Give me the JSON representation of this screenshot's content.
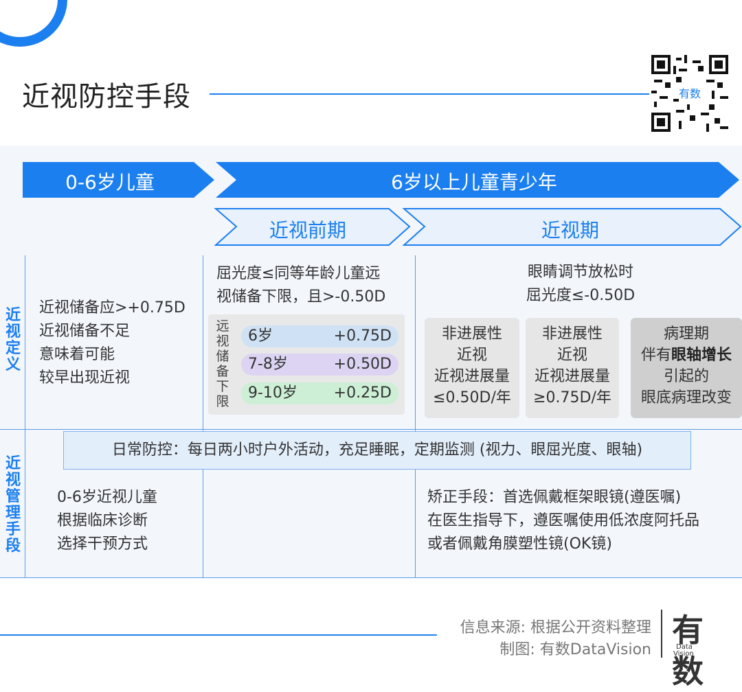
{
  "header": {
    "title": "近视防控手段"
  },
  "chevrons": {
    "age_0_6": "0-6岁儿童",
    "age_6_up": "6岁以上儿童青少年",
    "pre_myopia": "近视前期",
    "myopia": "近视期"
  },
  "side_labels": {
    "definition": "近视定义",
    "management": "近视管理手段"
  },
  "definition": {
    "col1_lines": [
      "近视储备应>+0.75D",
      "近视储备不足",
      "意味着可能",
      "较早出现近视"
    ],
    "col2_lines": [
      "屈光度≤同等年龄儿童远",
      "视储备下限，且>-0.50D"
    ],
    "reserve_label": "远视储备下限",
    "reserve_rows": [
      {
        "age": "6岁",
        "value": "+0.75D",
        "color": "#cfe2f5"
      },
      {
        "age": "7-8岁",
        "value": "+0.50D",
        "color": "#ddd4f3"
      },
      {
        "age": "9-10岁",
        "value": "+0.25D",
        "color": "#ccefd6"
      }
    ],
    "col3_lines": [
      "眼睛调节放松时",
      "屈光度≤-0.50D"
    ],
    "box1_lines": [
      "非进展性",
      "近视",
      "近视进展量",
      "≤0.50D/年"
    ],
    "box2_lines": [
      "非进展性",
      "近视",
      "近视进展量",
      "≥0.75D/年"
    ],
    "box3": {
      "line1": "病理期",
      "line2_pre": "伴有",
      "line2_bold": "眼轴增长",
      "line3": "引起的",
      "line4": "眼底病理改变"
    }
  },
  "management": {
    "daily": "日常防控：每日两小时户外活动，充足睡眠，定期监测 (视力、眼屈光度、眼轴)",
    "col1_lines": [
      "0-6岁近视儿童",
      "根据临床诊断",
      "选择干预方式"
    ],
    "col3_lines": [
      "矫正手段：首选佩戴框架眼镜(遵医嘱)",
      "在医生指导下，遵医嘱使用低浓度阿托品",
      "或者佩戴角膜塑性镜(OK镜)"
    ]
  },
  "footer": {
    "source": "信息来源: 根据公开资料整理",
    "credit": "制图: 有数DataVision",
    "logo_cn": "有数",
    "logo_en1": "Data",
    "logo_en2": "Vision"
  },
  "colors": {
    "accent": "#1b7ff0",
    "chevron_light": "#e8f1fc"
  }
}
